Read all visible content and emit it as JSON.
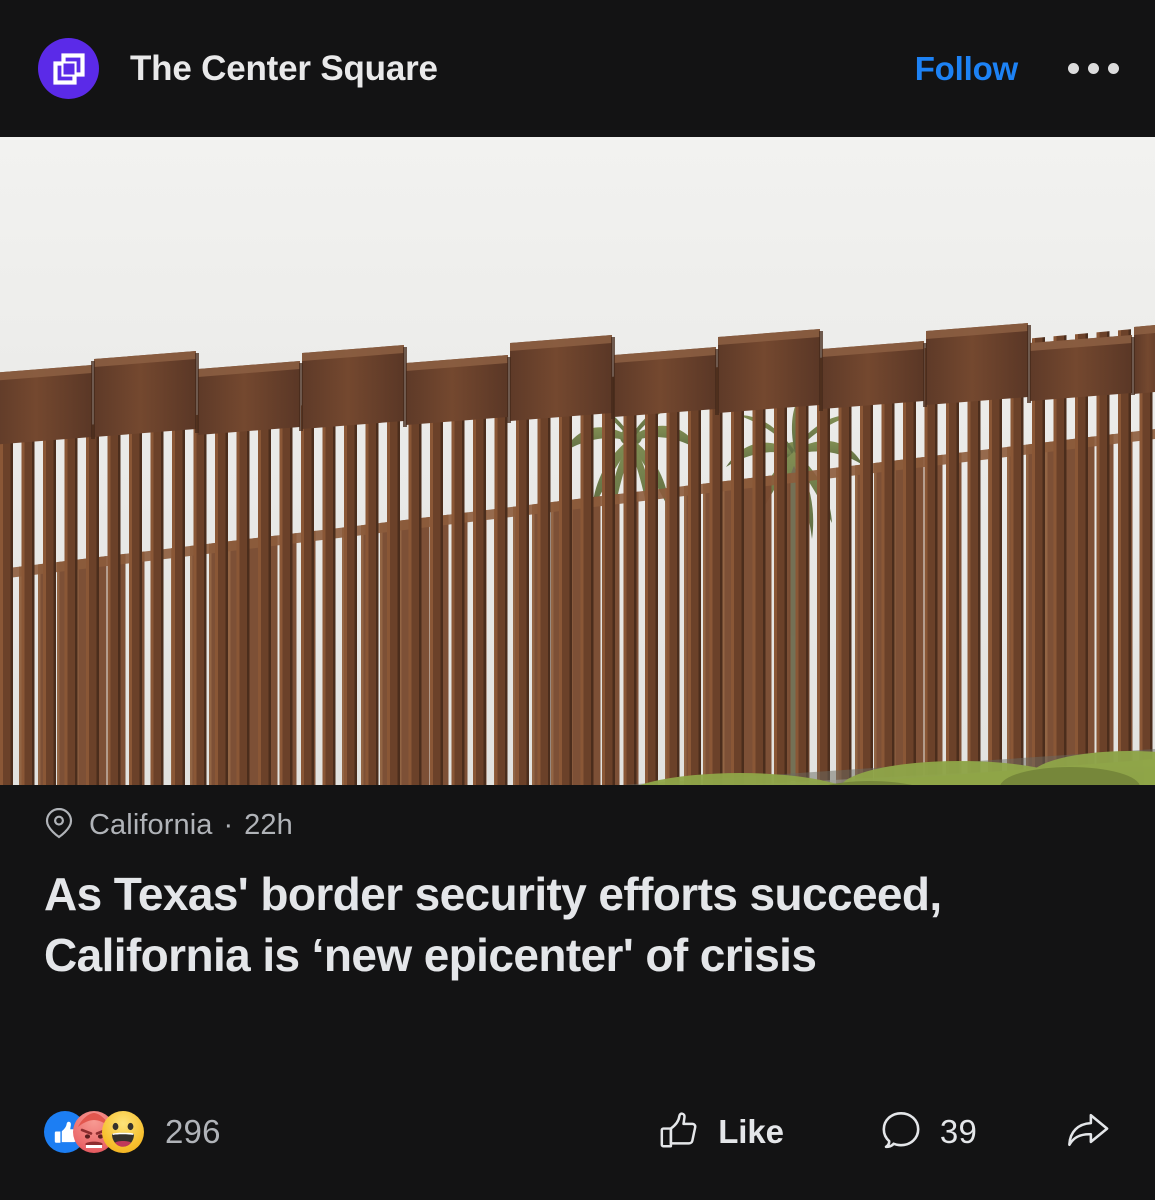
{
  "header": {
    "page_name": "The Center Square",
    "avatar_icon": "overlapping-squares-logo",
    "avatar_color": "#5b2ae8",
    "follow_label": "Follow",
    "more_icon": "ellipsis-icon"
  },
  "photo": {
    "alt": "Border wall — tall rust-brown steel bollard fence with palm trees visible behind it and green brush along the base",
    "sky_color": "#e9e9e7",
    "fence_color": "#6d4430",
    "vegetation_color": "#8aa24a"
  },
  "meta": {
    "location_icon": "location-pin-icon",
    "location": "California",
    "separator": "·",
    "timestamp": "22h"
  },
  "headline": "As Texas' border security efforts succeed, California is ‘new epicenter' of crisis",
  "footer": {
    "reactions": [
      {
        "name": "like-reaction",
        "color": "#1c7ef3"
      },
      {
        "name": "angry-reaction",
        "color": "#e9646f"
      },
      {
        "name": "haha-reaction",
        "color": "#f7b125"
      }
    ],
    "reaction_count": "296",
    "like": {
      "icon": "thumbs-up-icon",
      "label": "Like"
    },
    "comment": {
      "icon": "comment-bubble-icon",
      "count": "39"
    },
    "share": {
      "icon": "share-arrow-icon"
    }
  },
  "theme": {
    "background": "#131314",
    "text_primary": "#e4e6e9",
    "text_secondary": "#b0b3b8",
    "accent_blue": "#1d82f5"
  }
}
